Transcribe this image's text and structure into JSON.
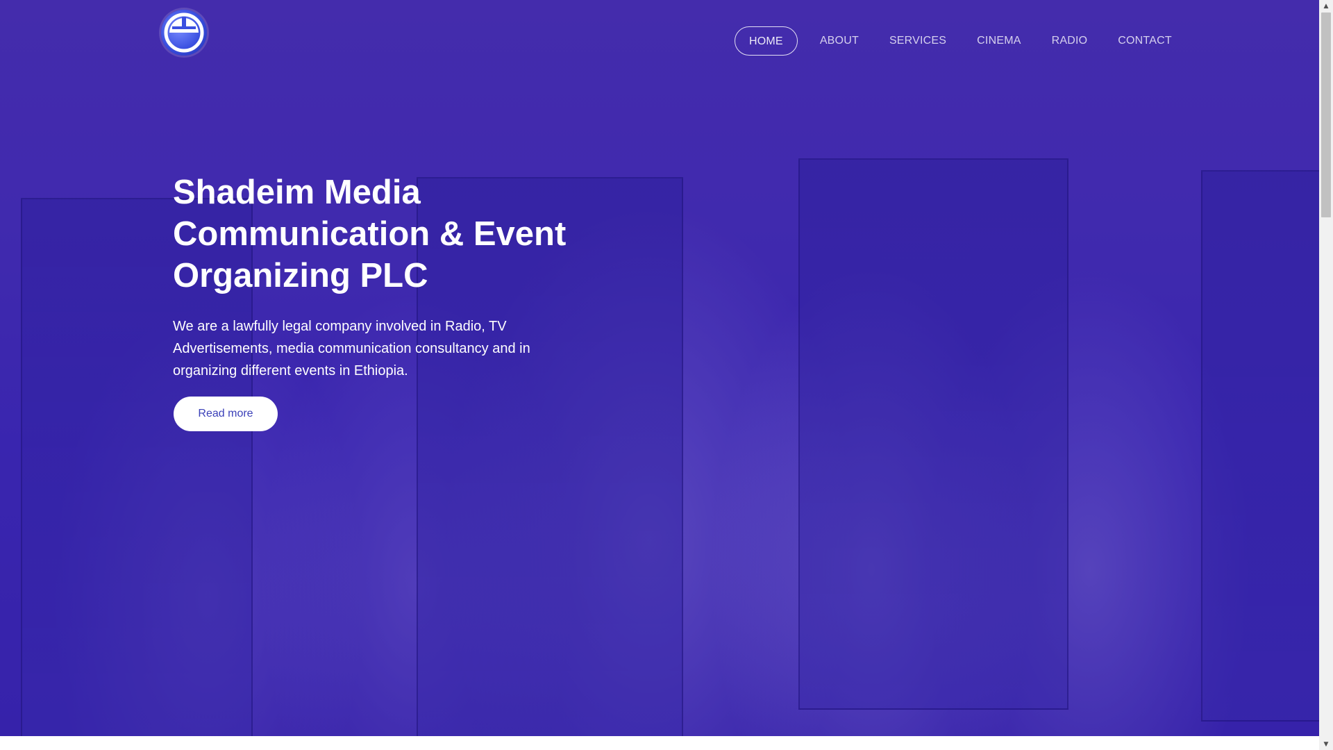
{
  "nav": {
    "items": [
      {
        "label": "HOME",
        "active": true
      },
      {
        "label": "ABOUT"
      },
      {
        "label": "SERVICES"
      },
      {
        "label": "CINEMA"
      },
      {
        "label": "RADIO"
      },
      {
        "label": "CONTACT"
      }
    ]
  },
  "hero": {
    "title": "Shadeim Media Communication & Event Organizing PLC",
    "description": "We are a lawfully legal company involved in Radio, TV Advertisements, media communication consultancy and in organizing different events in Ethiopia.",
    "cta_label": "Read more"
  },
  "colors": {
    "overlay": "#3f2aa3",
    "cta_text": "#3a3fb8",
    "logo": "#3a4fe0"
  },
  "icons": {
    "logo": "shadeim-logo-icon",
    "scroll_up": "chevron-up-icon",
    "scroll_down": "chevron-down-icon"
  }
}
